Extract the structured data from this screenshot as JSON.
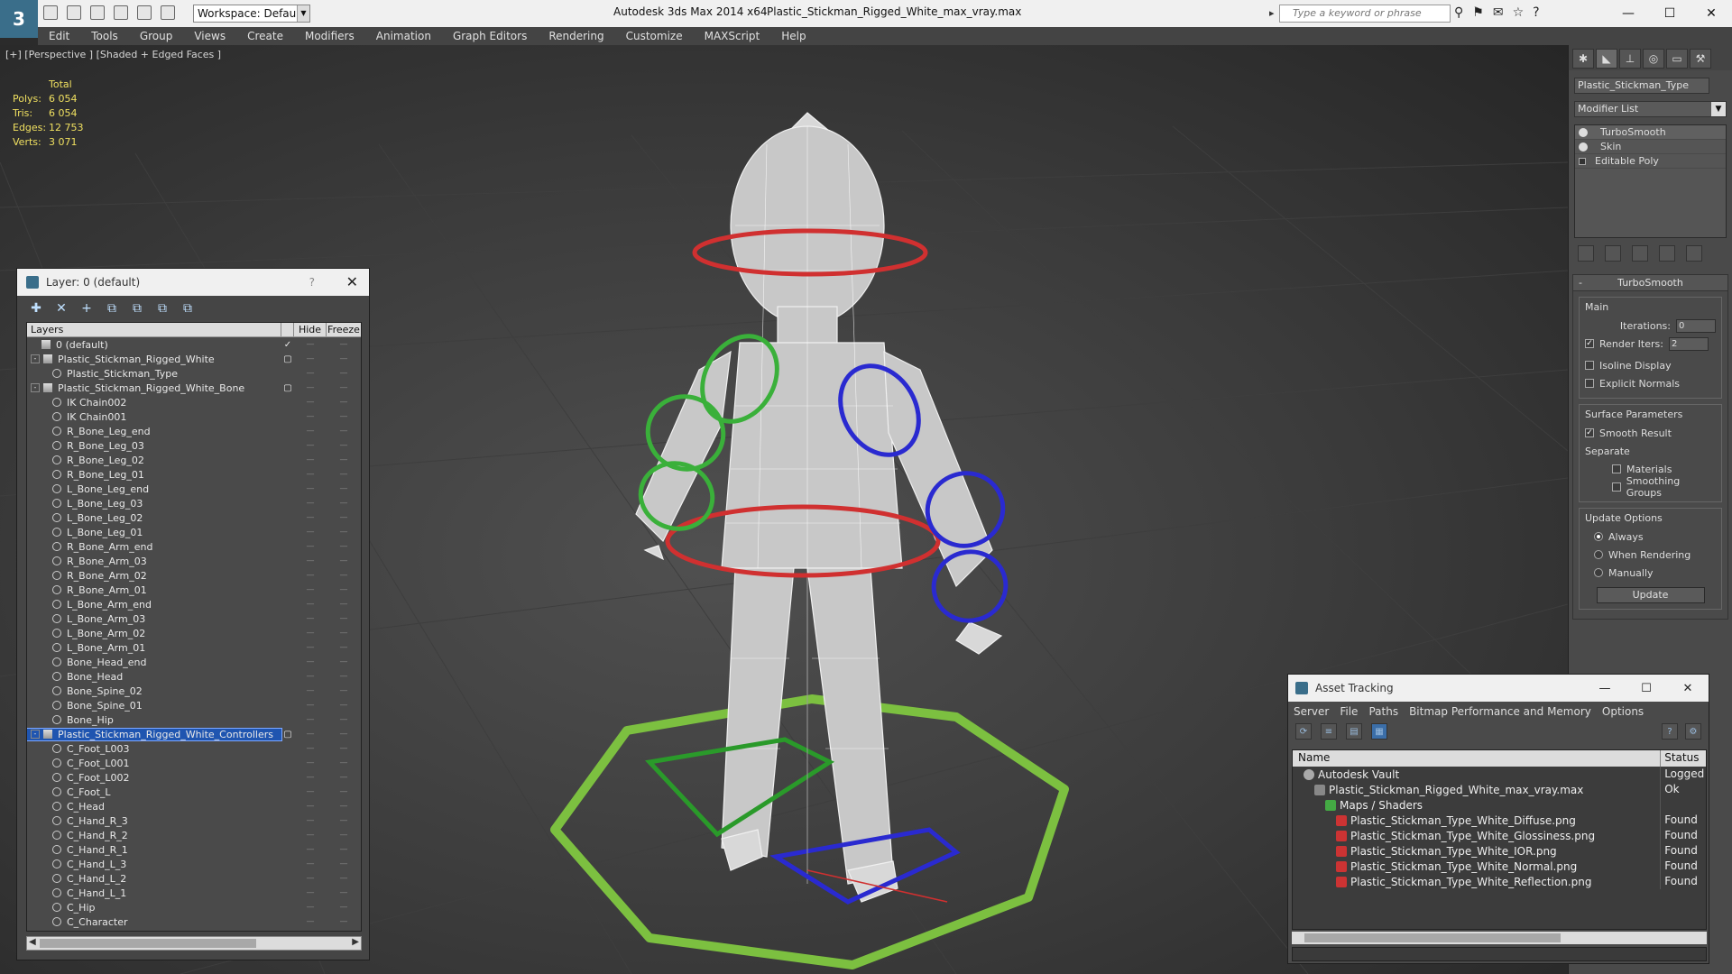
{
  "window": {
    "app_title": "Autodesk 3ds Max  2014 x64",
    "file_title": "Plastic_Stickman_Rigged_White_max_vray.max",
    "workspace": "Workspace: Default",
    "search_placeholder": "Type a keyword or phrase",
    "minimize": "—",
    "maximize": "☐",
    "close": "✕"
  },
  "menu": [
    "Edit",
    "Tools",
    "Group",
    "Views",
    "Create",
    "Modifiers",
    "Animation",
    "Graph Editors",
    "Rendering",
    "Customize",
    "MAXScript",
    "Help"
  ],
  "viewport": {
    "label": "[+] [Perspective ] [Shaded + Edged Faces ]",
    "stats": {
      "header": "Total",
      "rows": [
        {
          "k": "Polys:",
          "v": "6 054"
        },
        {
          "k": "Tris:",
          "v": "6 054"
        },
        {
          "k": "Edges:",
          "v": "12 753"
        },
        {
          "k": "Verts:",
          "v": "3 071"
        }
      ]
    }
  },
  "command_panel": {
    "object_name": "Plastic_Stickman_Type",
    "modifier_list": "Modifier List",
    "stack": [
      "TurboSmooth",
      "Skin",
      "Editable Poly"
    ],
    "rollout_title": "TurboSmooth",
    "main_group": "Main",
    "iterations_label": "Iterations:",
    "iterations_value": "0",
    "render_iters_label": "Render Iters:",
    "render_iters_value": "2",
    "isoline": "Isoline Display",
    "explicit_normals": "Explicit Normals",
    "surface_params": "Surface Parameters",
    "smooth_result": "Smooth Result",
    "separate": "Separate",
    "materials": "Materials",
    "smoothing_groups": "Smoothing Groups",
    "update_options": "Update Options",
    "always": "Always",
    "when_rendering": "When Rendering",
    "manually": "Manually",
    "update_button": "Update",
    "check_mark": "✓"
  },
  "layer_window": {
    "title": "Layer: 0 (default)",
    "help": "?",
    "close": "✕",
    "columns": {
      "layers": "Layers",
      "hide": "Hide",
      "freeze": "Freeze"
    },
    "rows": [
      {
        "name": "0 (default)",
        "level": 1,
        "type": "layer",
        "current": true
      },
      {
        "name": "Plastic_Stickman_Rigged_White",
        "level": 0,
        "type": "layer",
        "expand": "-",
        "box": true
      },
      {
        "name": "Plastic_Stickman_Type",
        "level": 2,
        "type": "object"
      },
      {
        "name": "Plastic_Stickman_Rigged_White_Bone",
        "level": 0,
        "type": "layer",
        "expand": "-",
        "box": true
      },
      {
        "name": "IK Chain002",
        "level": 2,
        "type": "object"
      },
      {
        "name": "IK Chain001",
        "level": 2,
        "type": "object"
      },
      {
        "name": "R_Bone_Leg_end",
        "level": 2,
        "type": "object"
      },
      {
        "name": "R_Bone_Leg_03",
        "level": 2,
        "type": "object"
      },
      {
        "name": "R_Bone_Leg_02",
        "level": 2,
        "type": "object"
      },
      {
        "name": "R_Bone_Leg_01",
        "level": 2,
        "type": "object"
      },
      {
        "name": "L_Bone_Leg_end",
        "level": 2,
        "type": "object"
      },
      {
        "name": "L_Bone_Leg_03",
        "level": 2,
        "type": "object"
      },
      {
        "name": "L_Bone_Leg_02",
        "level": 2,
        "type": "object"
      },
      {
        "name": "L_Bone_Leg_01",
        "level": 2,
        "type": "object"
      },
      {
        "name": "R_Bone_Arm_end",
        "level": 2,
        "type": "object"
      },
      {
        "name": "R_Bone_Arm_03",
        "level": 2,
        "type": "object"
      },
      {
        "name": "R_Bone_Arm_02",
        "level": 2,
        "type": "object"
      },
      {
        "name": "R_Bone_Arm_01",
        "level": 2,
        "type": "object"
      },
      {
        "name": "L_Bone_Arm_end",
        "level": 2,
        "type": "object"
      },
      {
        "name": "L_Bone_Arm_03",
        "level": 2,
        "type": "object"
      },
      {
        "name": "L_Bone_Arm_02",
        "level": 2,
        "type": "object"
      },
      {
        "name": "L_Bone_Arm_01",
        "level": 2,
        "type": "object"
      },
      {
        "name": "Bone_Head_end",
        "level": 2,
        "type": "object"
      },
      {
        "name": "Bone_Head",
        "level": 2,
        "type": "object"
      },
      {
        "name": "Bone_Spine_02",
        "level": 2,
        "type": "object"
      },
      {
        "name": "Bone_Spine_01",
        "level": 2,
        "type": "object"
      },
      {
        "name": "Bone_Hip",
        "level": 2,
        "type": "object"
      },
      {
        "name": "Plastic_Stickman_Rigged_White_Controllers",
        "level": 0,
        "type": "layer",
        "expand": "-",
        "box": true,
        "selected": true
      },
      {
        "name": "C_Foot_L003",
        "level": 2,
        "type": "object"
      },
      {
        "name": "C_Foot_L001",
        "level": 2,
        "type": "object"
      },
      {
        "name": "C_Foot_L002",
        "level": 2,
        "type": "object"
      },
      {
        "name": "C_Foot_L",
        "level": 2,
        "type": "object"
      },
      {
        "name": "C_Head",
        "level": 2,
        "type": "object"
      },
      {
        "name": "C_Hand_R_3",
        "level": 2,
        "type": "object"
      },
      {
        "name": "C_Hand_R_2",
        "level": 2,
        "type": "object"
      },
      {
        "name": "C_Hand_R_1",
        "level": 2,
        "type": "object"
      },
      {
        "name": "C_Hand_L_3",
        "level": 2,
        "type": "object"
      },
      {
        "name": "C_Hand_L_2",
        "level": 2,
        "type": "object"
      },
      {
        "name": "C_Hand_L_1",
        "level": 2,
        "type": "object"
      },
      {
        "name": "C_Hip",
        "level": 2,
        "type": "object"
      },
      {
        "name": "C_Character",
        "level": 2,
        "type": "object"
      }
    ]
  },
  "asset_window": {
    "title": "Asset Tracking",
    "menu": [
      "Server",
      "File",
      "Paths",
      "Bitmap Performance and Memory",
      "Options"
    ],
    "columns": {
      "name": "Name",
      "status": "Status"
    },
    "rows": [
      {
        "name": "Autodesk Vault",
        "indent": 1,
        "icon": "vault",
        "status": "Logged"
      },
      {
        "name": "Plastic_Stickman_Rigged_White_max_vray.max",
        "indent": 2,
        "icon": "max",
        "status": "Ok"
      },
      {
        "name": "Maps / Shaders",
        "indent": 3,
        "icon": "map",
        "status": ""
      },
      {
        "name": "Plastic_Stickman_Type_White_Diffuse.png",
        "indent": 4,
        "icon": "png",
        "status": "Found"
      },
      {
        "name": "Plastic_Stickman_Type_White_Glossiness.png",
        "indent": 4,
        "icon": "png",
        "status": "Found"
      },
      {
        "name": "Plastic_Stickman_Type_White_IOR.png",
        "indent": 4,
        "icon": "png",
        "status": "Found"
      },
      {
        "name": "Plastic_Stickman_Type_White_Normal.png",
        "indent": 4,
        "icon": "png",
        "status": "Found"
      },
      {
        "name": "Plastic_Stickman_Type_White_Reflection.png",
        "indent": 4,
        "icon": "png",
        "status": "Found"
      }
    ]
  },
  "colors": {
    "controller_red": "#d03030",
    "controller_green": "#3ab03a",
    "controller_blue": "#2a2ad0",
    "ground_ring": "#7cc040",
    "selection": "#1f55b0"
  }
}
